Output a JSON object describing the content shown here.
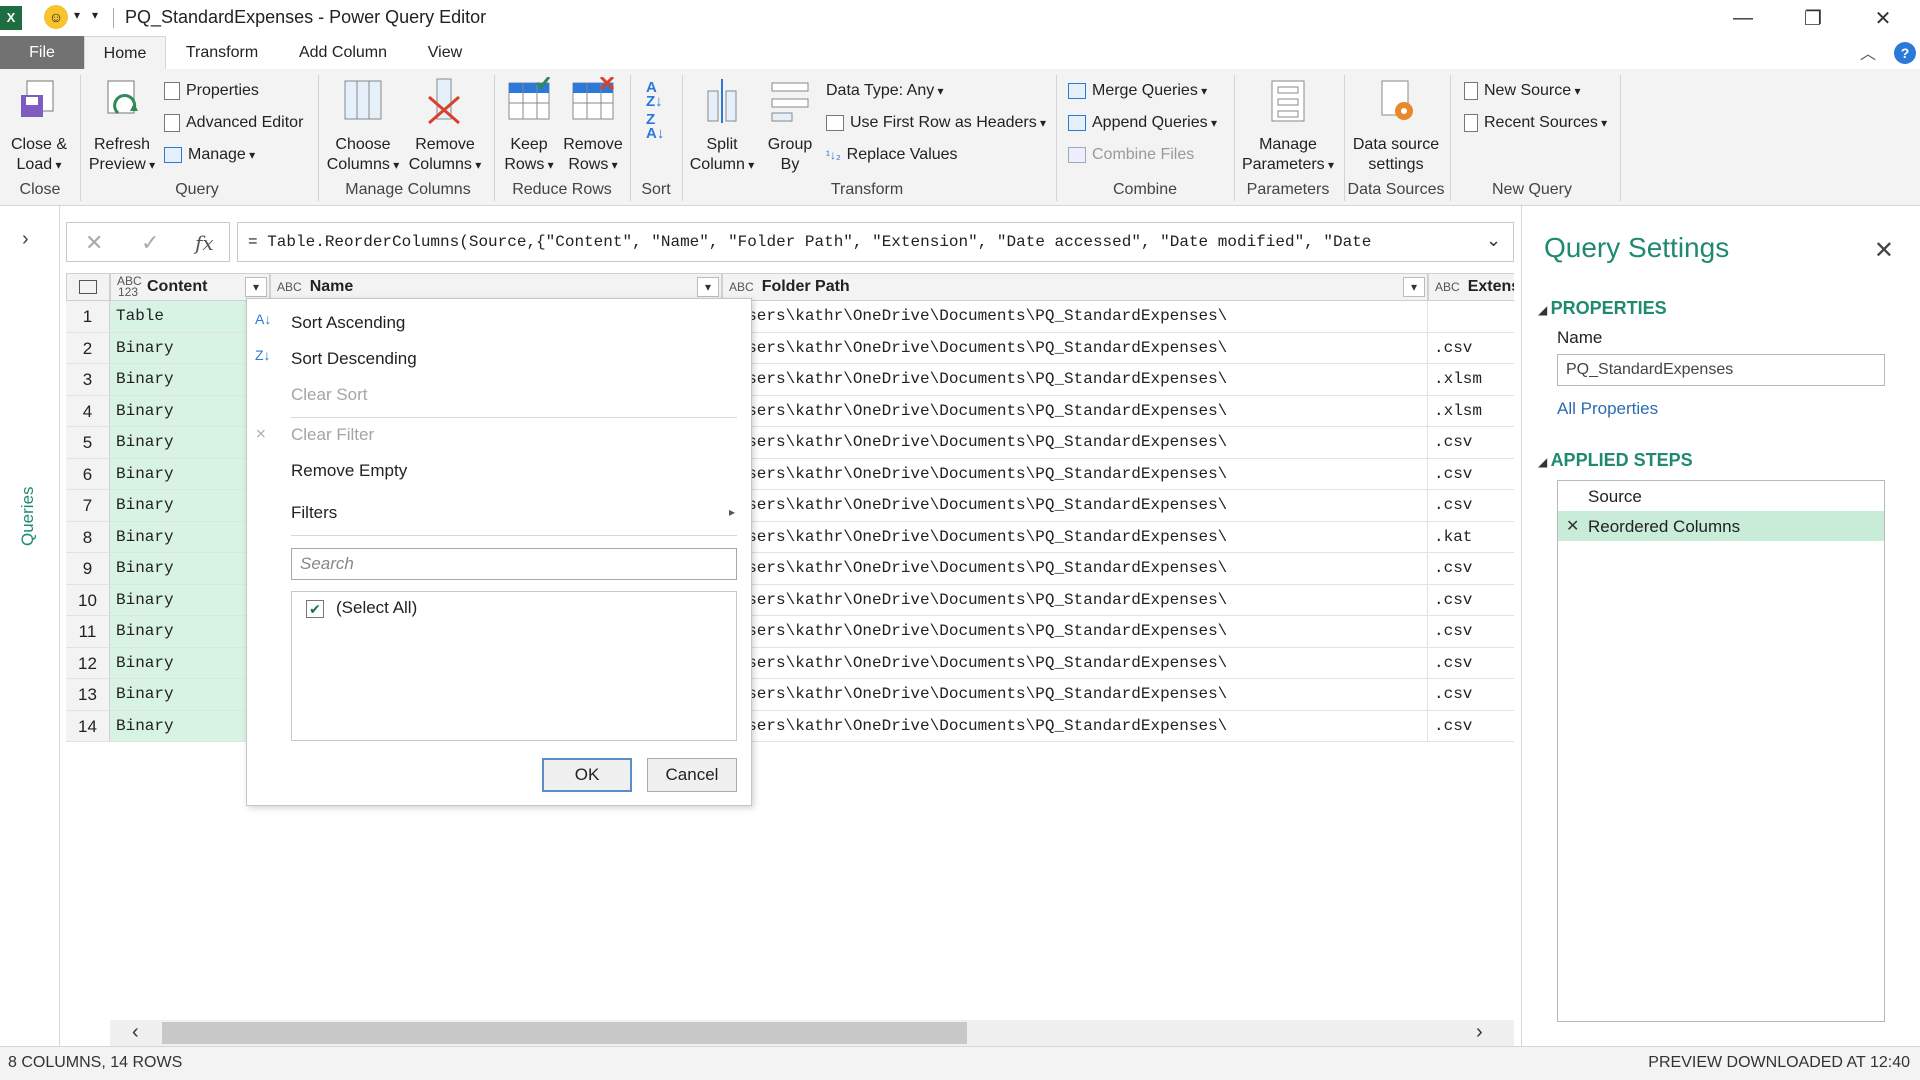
{
  "window": {
    "title": "PQ_StandardExpenses - Power Query Editor",
    "app_icon": "excel-icon",
    "quick_access": "smiley-icon"
  },
  "tabs": [
    {
      "label": "File"
    },
    {
      "label": "Home"
    },
    {
      "label": "Transform"
    },
    {
      "label": "Add Column"
    },
    {
      "label": "View"
    }
  ],
  "ribbon": {
    "close": {
      "close_load": [
        "Close &",
        "Load"
      ],
      "group": "Close"
    },
    "query": {
      "refresh": [
        "Refresh",
        "Preview"
      ],
      "properties": "Properties",
      "advanced_editor": "Advanced Editor",
      "manage": "Manage",
      "group": "Query"
    },
    "manage_columns": {
      "choose": [
        "Choose",
        "Columns"
      ],
      "remove": [
        "Remove",
        "Columns"
      ],
      "group": "Manage Columns"
    },
    "reduce_rows": {
      "keep": [
        "Keep",
        "Rows"
      ],
      "remove": [
        "Remove",
        "Rows"
      ],
      "group": "Reduce Rows"
    },
    "sort": {
      "group": "Sort"
    },
    "transform": {
      "split": [
        "Split",
        "Column"
      ],
      "group_by": [
        "Group",
        "By"
      ],
      "data_type": "Data Type: Any",
      "first_row": "Use First Row as Headers",
      "replace": "Replace Values",
      "group": "Transform"
    },
    "combine": {
      "merge": "Merge Queries",
      "append": "Append Queries",
      "combine_files": "Combine Files",
      "group": "Combine"
    },
    "parameters": {
      "manage": [
        "Manage",
        "Parameters"
      ],
      "group": "Parameters"
    },
    "data_sources": {
      "settings": [
        "Data source",
        "settings"
      ],
      "group": "Data Sources"
    },
    "new_query": {
      "new_source": "New Source",
      "recent": "Recent Sources",
      "group": "New Query"
    }
  },
  "queries_pane": {
    "label": "Queries"
  },
  "formula_bar": {
    "text": "= Table.ReorderColumns(Source,{\"Content\", \"Name\", \"Folder Path\", \"Extension\", \"Date accessed\", \"Date modified\", \"Date"
  },
  "grid": {
    "columns": [
      {
        "name": "Content",
        "type": "ABC 123"
      },
      {
        "name": "Name",
        "type": "ABC"
      },
      {
        "name": "Folder Path",
        "type": "ABC"
      },
      {
        "name": "Extens",
        "type": "ABC"
      }
    ],
    "rows": [
      {
        "num": "1",
        "content": "Table",
        "path": "\\Users\\kathr\\OneDrive\\Documents\\PQ_StandardExpenses\\",
        "ext": ""
      },
      {
        "num": "2",
        "content": "Binary",
        "path": "\\Users\\kathr\\OneDrive\\Documents\\PQ_StandardExpenses\\",
        "ext": ".csv"
      },
      {
        "num": "3",
        "content": "Binary",
        "path": "\\Users\\kathr\\OneDrive\\Documents\\PQ_StandardExpenses\\",
        "ext": ".xlsm"
      },
      {
        "num": "4",
        "content": "Binary",
        "path": "\\Users\\kathr\\OneDrive\\Documents\\PQ_StandardExpenses\\",
        "ext": ".xlsm"
      },
      {
        "num": "5",
        "content": "Binary",
        "path": "\\Users\\kathr\\OneDrive\\Documents\\PQ_StandardExpenses\\",
        "ext": ".csv"
      },
      {
        "num": "6",
        "content": "Binary",
        "path": "\\Users\\kathr\\OneDrive\\Documents\\PQ_StandardExpenses\\",
        "ext": ".csv"
      },
      {
        "num": "7",
        "content": "Binary",
        "path": "\\Users\\kathr\\OneDrive\\Documents\\PQ_StandardExpenses\\",
        "ext": ".csv"
      },
      {
        "num": "8",
        "content": "Binary",
        "path": "\\Users\\kathr\\OneDrive\\Documents\\PQ_StandardExpenses\\",
        "ext": ".kat"
      },
      {
        "num": "9",
        "content": "Binary",
        "path": "\\Users\\kathr\\OneDrive\\Documents\\PQ_StandardExpenses\\",
        "ext": ".csv"
      },
      {
        "num": "10",
        "content": "Binary",
        "path": "\\Users\\kathr\\OneDrive\\Documents\\PQ_StandardExpenses\\",
        "ext": ".csv"
      },
      {
        "num": "11",
        "content": "Binary",
        "path": "\\Users\\kathr\\OneDrive\\Documents\\PQ_StandardExpenses\\",
        "ext": ".csv"
      },
      {
        "num": "12",
        "content": "Binary",
        "path": "\\Users\\kathr\\OneDrive\\Documents\\PQ_StandardExpenses\\",
        "ext": ".csv"
      },
      {
        "num": "13",
        "content": "Binary",
        "path": "\\Users\\kathr\\OneDrive\\Documents\\PQ_StandardExpenses\\",
        "ext": ".csv"
      },
      {
        "num": "14",
        "content": "Binary",
        "path": "\\Users\\kathr\\OneDrive\\Documents\\PQ_StandardExpenses\\",
        "ext": ".csv"
      }
    ]
  },
  "filter_menu": {
    "sort_asc": "Sort Ascending",
    "sort_desc": "Sort Descending",
    "clear_sort": "Clear Sort",
    "clear_filter": "Clear Filter",
    "remove_empty": "Remove Empty",
    "filters": "Filters",
    "search_placeholder": "Search",
    "select_all": "(Select All)",
    "ok": "OK",
    "cancel": "Cancel"
  },
  "settings": {
    "title": "Query Settings",
    "properties_header": "PROPERTIES",
    "name_label": "Name",
    "name_value": "PQ_StandardExpenses",
    "all_properties": "All Properties",
    "steps_header": "APPLIED STEPS",
    "steps": [
      {
        "label": "Source"
      },
      {
        "label": "Reordered Columns"
      }
    ]
  },
  "status": {
    "left": "8 COLUMNS, 14 ROWS",
    "right": "PREVIEW DOWNLOADED AT 12:40"
  },
  "colors": {
    "accent": "#1f8a6e",
    "content_fill": "#d8f2e4",
    "selected_step": "#c8ecd8"
  }
}
